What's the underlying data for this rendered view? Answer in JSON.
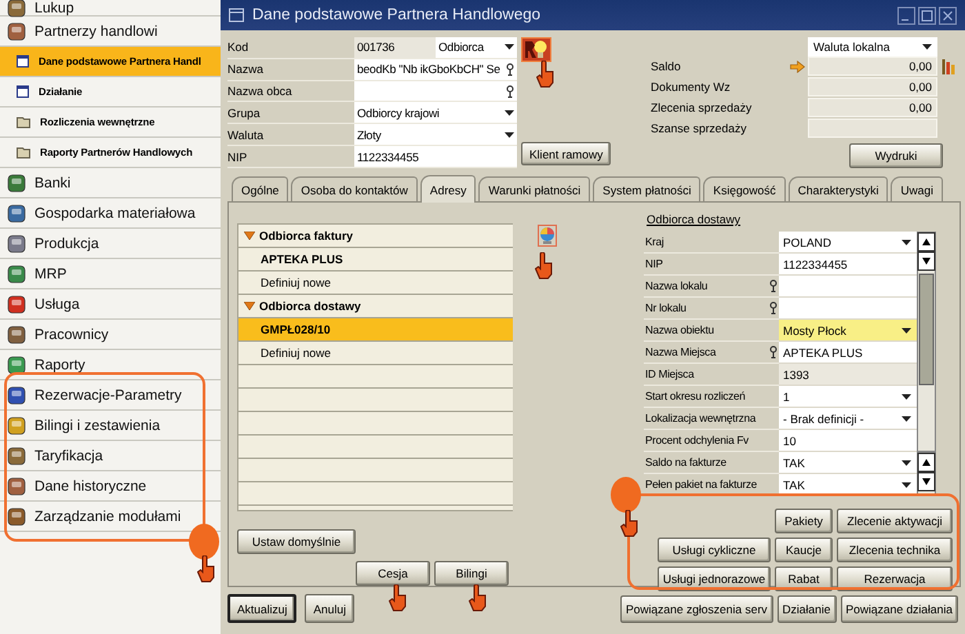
{
  "sidebar": {
    "items": [
      {
        "label": "Lukup",
        "kind": "module",
        "selected": false
      },
      {
        "label": "Partnerzy handlowi",
        "kind": "module",
        "selected": false
      },
      {
        "label": "Dane podstawowe Partnera Handl",
        "kind": "form",
        "selected": true
      },
      {
        "label": "Działanie",
        "kind": "form",
        "selected": false
      },
      {
        "label": "Rozliczenia wewnętrzne",
        "kind": "folder",
        "selected": false
      },
      {
        "label": "Raporty Partnerów Handlowych",
        "kind": "folder",
        "selected": false
      },
      {
        "label": "Banki",
        "kind": "module",
        "selected": false
      },
      {
        "label": "Gospodarka materiałowa",
        "kind": "module",
        "selected": false
      },
      {
        "label": "Produkcja",
        "kind": "module",
        "selected": false
      },
      {
        "label": "MRP",
        "kind": "module",
        "selected": false
      },
      {
        "label": "Usługa",
        "kind": "module",
        "selected": false
      },
      {
        "label": "Pracownicy",
        "kind": "module",
        "selected": false
      },
      {
        "label": "Raporty",
        "kind": "module",
        "selected": false
      },
      {
        "label": "Rezerwacje-Parametry",
        "kind": "module",
        "selected": false
      },
      {
        "label": "Bilingi i zestawienia",
        "kind": "module",
        "selected": false
      },
      {
        "label": "Taryfikacja",
        "kind": "module",
        "selected": false
      },
      {
        "label": "Dane historyczne",
        "kind": "module",
        "selected": false
      },
      {
        "label": "Zarządzanie modułami",
        "kind": "module",
        "selected": false
      }
    ]
  },
  "window": {
    "title": "Dane podstawowe Partnera Handlowego"
  },
  "header_form": {
    "fields": [
      {
        "label": "Kod",
        "kind": "readonly",
        "value": "001736",
        "type_value": "Odbiorca",
        "picker": false
      },
      {
        "label": "Nazwa",
        "kind": "text",
        "value": "beodKb \"Nb ikGboKbCH\" Se",
        "picker": true
      },
      {
        "label": "Nazwa obca",
        "kind": "text",
        "picker": true
      },
      {
        "label": "Grupa",
        "kind": "dropdown",
        "value": "Odbiorcy krajowi",
        "picker": false
      },
      {
        "label": "Waluta",
        "kind": "dropdown",
        "value": "Złoty",
        "picker": false
      },
      {
        "label": "NIP",
        "kind": "text",
        "value": "1122334455",
        "picker": false
      }
    ]
  },
  "framework_button": "Klient ramowy",
  "balance_panel": {
    "currency": "Waluta lokalna",
    "rows": [
      {
        "label": "Saldo",
        "value": "0,00",
        "link": true,
        "chart": true
      },
      {
        "label": "Dokumenty Wz",
        "value": "0,00",
        "link": false,
        "chart": false
      },
      {
        "label": "Zlecenia sprzedaży",
        "value": "0,00",
        "link": false,
        "chart": false
      },
      {
        "label": "Szanse sprzedaży",
        "link": false,
        "chart": false
      }
    ]
  },
  "print_button": "Wydruki",
  "tabs": [
    {
      "label": "Ogólne",
      "selected": false
    },
    {
      "label": "Osoba do kontaktów",
      "selected": false
    },
    {
      "label": "Adresy",
      "selected": true
    },
    {
      "label": "Warunki płatności",
      "selected": false
    },
    {
      "label": "System płatności",
      "selected": false
    },
    {
      "label": "Księgowość",
      "selected": false
    },
    {
      "label": "Charakterystyki",
      "selected": false
    },
    {
      "label": "Uwagi",
      "selected": false
    }
  ],
  "address_list": {
    "groups": [
      {
        "label": "Odbiorca faktury",
        "expanded": true,
        "children": [
          {
            "label": "APTEKA PLUS",
            "kind": "entry",
            "selected": false
          },
          {
            "label": "Definiuj nowe",
            "kind": "action",
            "selected": false
          }
        ]
      },
      {
        "label": "Odbiorca dostawy",
        "expanded": true,
        "children": [
          {
            "label": "GMPŁ028/10",
            "kind": "entry",
            "selected": true
          },
          {
            "label": "Definiuj nowe",
            "kind": "action",
            "selected": false
          }
        ]
      }
    ]
  },
  "delivery_panel": {
    "title": "Odbiorca dostawy",
    "rows": [
      {
        "label": "Kraj",
        "kind": "dropdown",
        "value": "POLAND",
        "picker": false,
        "highlighted": false
      },
      {
        "label": "NIP",
        "kind": "text",
        "value": "1122334455",
        "picker": false,
        "highlighted": false
      },
      {
        "label": "Nazwa lokalu",
        "kind": "text",
        "picker": true,
        "highlighted": false
      },
      {
        "label": "Nr lokalu",
        "kind": "text",
        "picker": true,
        "highlighted": false
      },
      {
        "label": "Nazwa obiektu",
        "kind": "dropdown",
        "value": "Mosty Płock",
        "picker": false,
        "highlighted": true
      },
      {
        "label": "Nazwa Miejsca",
        "kind": "text",
        "value": "APTEKA PLUS",
        "picker": true,
        "highlighted": false
      },
      {
        "label": "ID Miejsca",
        "kind": "readonly",
        "value": "1393",
        "picker": false,
        "highlighted": false
      },
      {
        "label": "Start okresu rozliczeń",
        "kind": "dropdown",
        "value": "1",
        "picker": false,
        "highlighted": false
      },
      {
        "label": "Lokalizacja wewnętrzna",
        "kind": "dropdown",
        "value": "- Brak definicji -",
        "picker": false,
        "highlighted": false
      },
      {
        "label": "Procent odchylenia Fv",
        "kind": "text",
        "value": "10",
        "picker": false,
        "highlighted": false
      },
      {
        "label": "Saldo na fakturze",
        "kind": "dropdown",
        "value": "TAK",
        "picker": false,
        "highlighted": false
      },
      {
        "label": "Pełen pakiet na fakturze",
        "kind": "dropdown",
        "value": "TAK",
        "picker": false,
        "highlighted": false
      }
    ]
  },
  "default_button": "Ustaw domyślnie",
  "side_buttons": [
    "Cesja",
    "Bilingi"
  ],
  "service_buttons": [
    {
      "buttons": [
        "Pakiety",
        "Zlecenie aktywacji"
      ]
    },
    {
      "buttons": [
        "Usługi cykliczne",
        "Kaucje",
        "Zlecenia technika"
      ]
    },
    {
      "buttons": [
        "Usługi jednorazowe",
        "Rabat",
        "Rezerwacja"
      ]
    }
  ],
  "footer": {
    "left_buttons": [
      {
        "label": "Aktualizuj",
        "default": true
      },
      {
        "label": "Anuluj",
        "default": false
      }
    ],
    "right_buttons": [
      "Powiązane zgłoszenia serv",
      "Działanie",
      "Powiązane działania"
    ]
  }
}
